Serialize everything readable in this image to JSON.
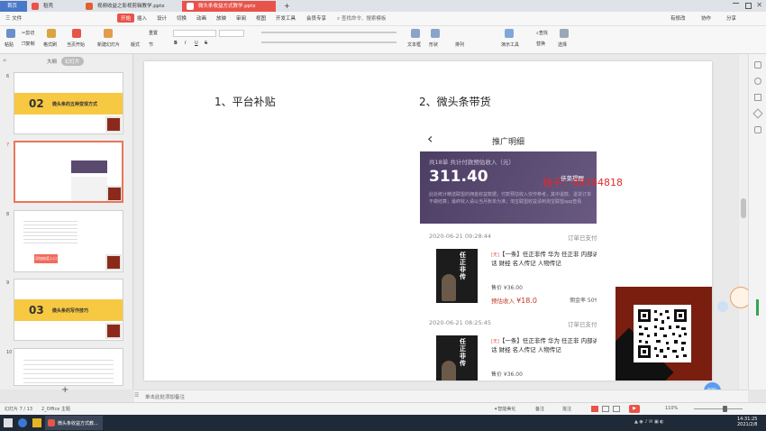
{
  "titlebar": {
    "tabs": [
      {
        "label": "首页"
      },
      {
        "label": "稻壳"
      },
      {
        "label": "视频收益之影视剪辑教学.pptx"
      },
      {
        "label": "微头条收益方式教学.pptx"
      }
    ],
    "new_tab": "+"
  },
  "menubar": {
    "file": "三 文件",
    "items": [
      "开始",
      "插入",
      "设计",
      "切换",
      "动画",
      "放映",
      "审阅",
      "视图",
      "开发工具",
      "会员专享"
    ],
    "search": "查找命令、搜索模板",
    "right": [
      "有修改",
      "协作",
      "分享"
    ]
  },
  "ribbon": {
    "labels": [
      "粘贴",
      "剪切",
      "复制",
      "格式刷",
      "当页开始",
      "新建幻灯片",
      "版式",
      "节",
      "重置",
      "文本框",
      "形状",
      "排列",
      "演示工具",
      "查找",
      "替换",
      "选择"
    ],
    "bold": "B",
    "italic": "I",
    "underline": "U",
    "strike": "S"
  },
  "panel": {
    "outline_tab": "大纲",
    "slides_tab": "幻灯片",
    "add": "+",
    "thumbs": [
      {
        "num": "6",
        "number": "02",
        "title": "微头条的五种变现方式"
      },
      {
        "num": "7"
      },
      {
        "num": "8",
        "button": "添加抽奖入口"
      },
      {
        "num": "9",
        "number": "03",
        "title": "微头条的写作技巧"
      },
      {
        "num": "10"
      }
    ]
  },
  "slide": {
    "heading_left": "1、平台补贴",
    "heading_right": "2、微头条带货",
    "phone": {
      "back": "‹",
      "title": "推广明细",
      "summary_label": "共18单 共计付款预估收入（元）",
      "amount": "311.40",
      "badge": "佳菜提醒",
      "note": "此处统计精选联盟的佣金收益数据；付款预估收入仅作参考，其中退款、退货订单不做结算；最终收入请以当月账单为准；淘宝联盟收益请到淘宝联盟app查看",
      "orders": [
        {
          "time": "2020-06-21 09:28:44",
          "status": "订单已支付",
          "tag": "[无]",
          "desc": "【一条】任正非传 华为 任正非 内部讲话 财经 名人传记 人物传记",
          "price": "售价 ¥36.00",
          "income_label": "预估收入",
          "income": "¥18.0",
          "commission": "佣金率 50%",
          "book_title": "任正非传"
        },
        {
          "time": "2020-06-21 08:25:45",
          "status": "订单已支付",
          "tag": "[无]",
          "desc": "【一条】任正非传 华为 任正非 内部讲话 财经 名人传记 人物传记",
          "price": "售价 ¥36.00",
          "book_title": "任正非传"
        }
      ]
    },
    "watermark": "柚子：88364818"
  },
  "notes": {
    "placeholder": "单击此处添加备注"
  },
  "status": {
    "slide_info": "幻灯片 7 / 13",
    "theme": "2_Office 主题",
    "beautify": "智能美化",
    "notes": "备注",
    "annotate": "批注",
    "zoom": "110%",
    "percent_badge": "60%"
  },
  "taskbar": {
    "window": "微头条收益方式教...",
    "time": "14:31:25",
    "date": "2021/2/8"
  },
  "colors": {
    "accent": "#e8534a",
    "wps_red": "#d83b2f",
    "phone_purple": "#5a4a6e",
    "watermark": "#e02a2a"
  }
}
